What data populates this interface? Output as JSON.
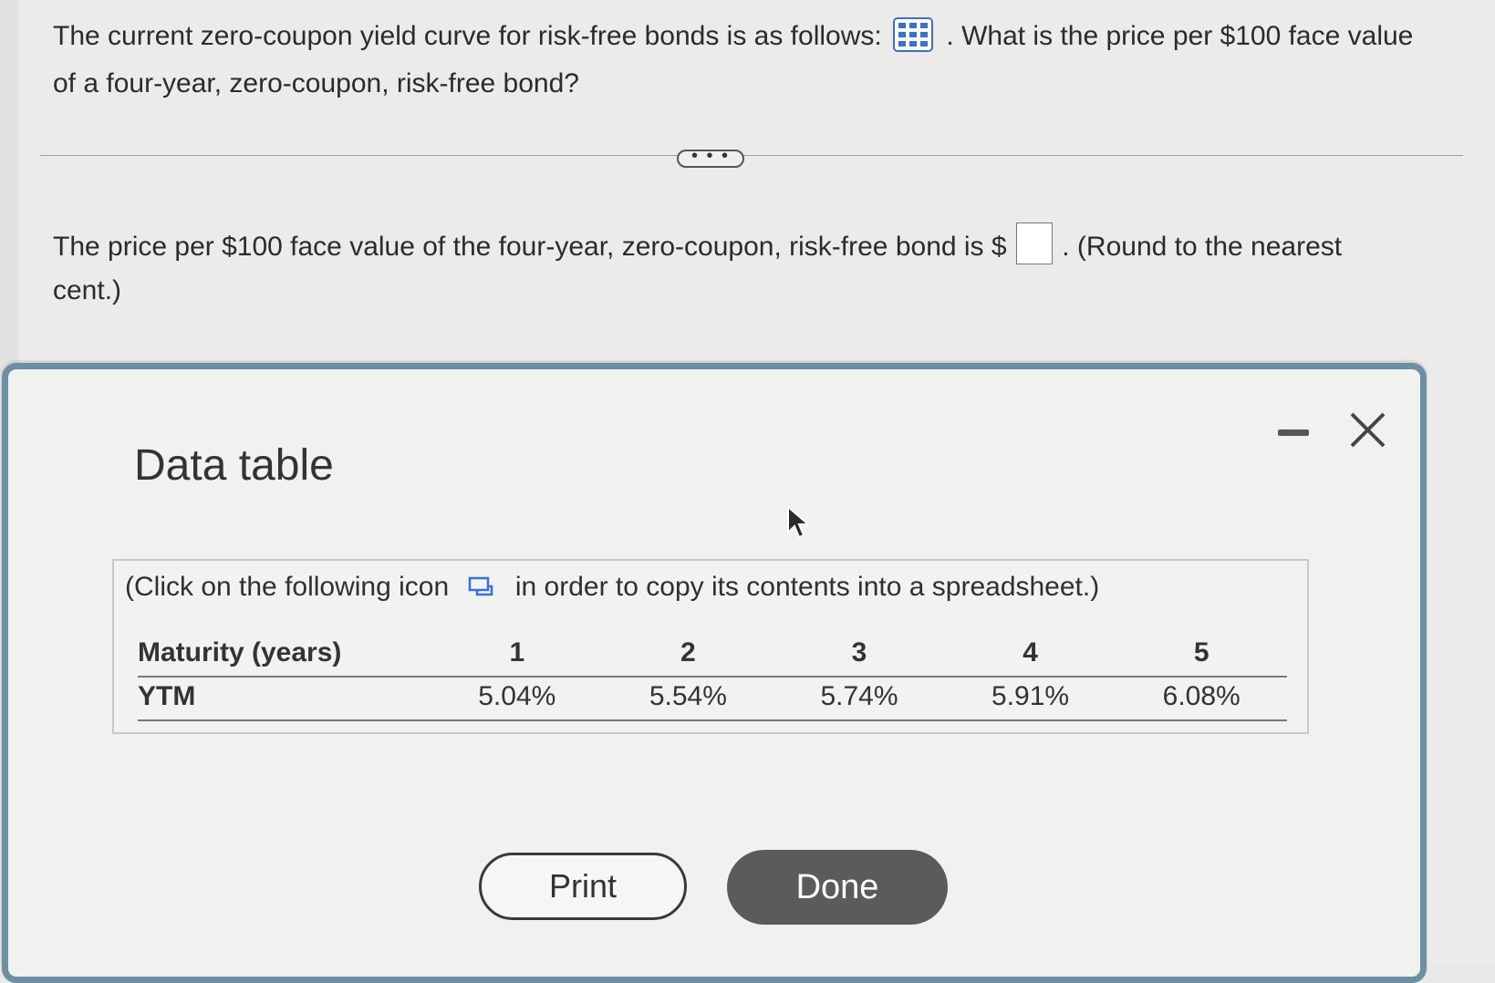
{
  "question": {
    "text_before_icon": "The current zero-coupon yield curve for risk-free bonds is as follows:",
    "text_after_icon": ". What is the price per $100 face value of a four-year, zero-coupon, risk-free bond?",
    "icon": "table-grid-icon"
  },
  "expand_button": {
    "label": "• • •"
  },
  "answer": {
    "text_before_box": "The price per $100 face value of the four-year, zero-coupon, risk-free bond is $",
    "answer_value": "",
    "text_after_box": ". (Round to the nearest cent.)"
  },
  "modal": {
    "title": "Data table",
    "instruction_before": "(Click on the following icon",
    "instruction_after": "in order to copy its contents into a spreadsheet.)",
    "table": {
      "row_headers": [
        "Maturity (years)",
        "YTM"
      ],
      "maturities": [
        "1",
        "2",
        "3",
        "4",
        "5"
      ],
      "ytm": [
        "5.04%",
        "5.54%",
        "5.74%",
        "5.91%",
        "6.08%"
      ]
    },
    "print_label": "Print",
    "done_label": "Done"
  },
  "colors": {
    "accent_blue": "#3b6fd6",
    "modal_border": "#6d8fa3",
    "done_button": "#5b5b5b"
  }
}
